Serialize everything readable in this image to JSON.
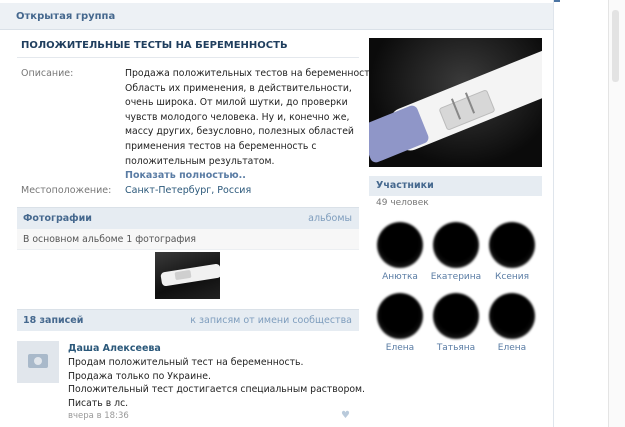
{
  "header": {
    "title": "Открытая группа"
  },
  "group": {
    "title": "ПОЛОЖИТЕЛЬНЫЕ ТЕСТЫ НА БЕРЕМЕННОСТЬ",
    "description_label": "Описание:",
    "description_lines": [
      "Продажа положительных тестов на беременность.",
      "Область их применения, в действительности,",
      "очень широка. От милой шутки, до проверки",
      "чувств молодого человека. Ну и, конечно же,",
      "массу других, безусловно, полезных областей",
      "применения тестов на беременность с",
      "положительным результатом."
    ],
    "show_full": "Показать полностью..",
    "location_label": "Местоположение:",
    "location_value": "Санкт-Петербург, Россия"
  },
  "photos": {
    "title": "Фотографии",
    "albums_link": "альбомы",
    "album_info": "В основном альбоме 1 фотография"
  },
  "wall": {
    "count_label": "18 записей",
    "community_link": "к записям от имени сообщества",
    "post": {
      "author": "Даша Алексеева",
      "lines": [
        "Продам положительный тест на беременность.",
        "Продажа только по Украине.",
        "Положительный тест достигается специальным раствором.",
        "Писать в лс."
      ],
      "time": "вчера в 18:36"
    }
  },
  "members": {
    "title": "Участники",
    "count": "49 человек",
    "list": [
      {
        "name": "Анютка"
      },
      {
        "name": "Екатерина"
      },
      {
        "name": "Ксения"
      },
      {
        "name": "Елена"
      },
      {
        "name": "Татьяна"
      },
      {
        "name": "Елена"
      }
    ]
  },
  "icons": {
    "camera": "camera-icon",
    "heart": "heart-icon"
  },
  "colors": {
    "accent": "#45688e",
    "link": "#2b587a",
    "bar_bg": "#e6ecf2"
  }
}
